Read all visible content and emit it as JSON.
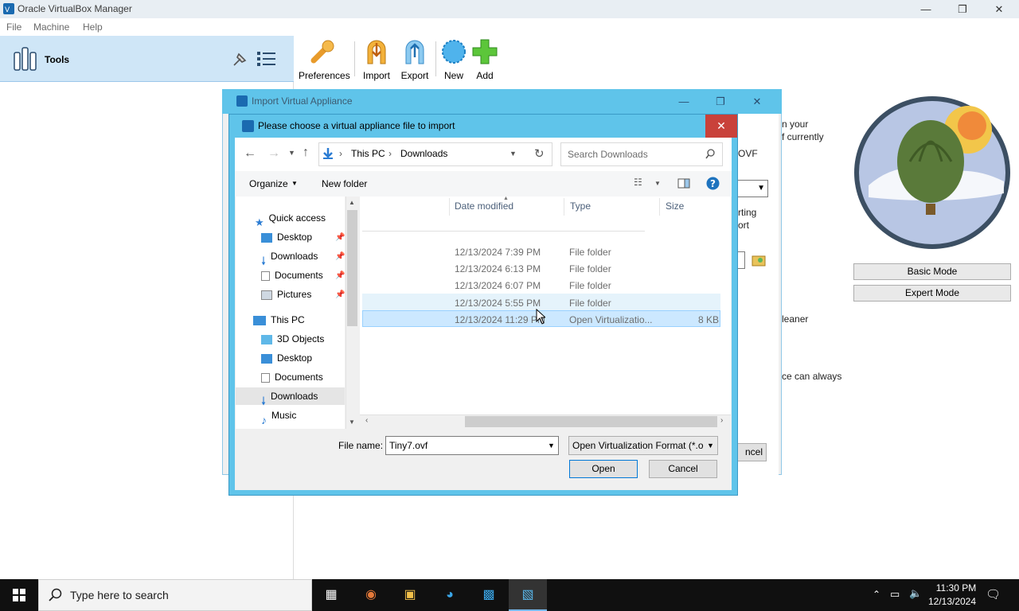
{
  "app": {
    "title": "Oracle VirtualBox Manager",
    "menu": [
      "File",
      "Machine",
      "Help"
    ],
    "tools_label": "Tools",
    "toolbar": [
      "Preferences",
      "Import",
      "Export",
      "New",
      "Add"
    ],
    "window_controls": {
      "minimize": "—",
      "restore": "❐",
      "close": "✕"
    }
  },
  "wizard": {
    "title": "Import Virtual Appliance",
    "side_texts": [
      "n your",
      "f currently",
      "OVF",
      "rting",
      "ort",
      "leaner",
      "ce can always",
      "ncel"
    ],
    "basic_mode": "Basic Mode",
    "expert_mode": "Expert Mode"
  },
  "dialog": {
    "title": "Please choose a virtual appliance file to import",
    "close": "✕",
    "breadcrumb": [
      "This PC",
      "Downloads"
    ],
    "search_placeholder": "Search Downloads",
    "organize": "Organize",
    "new_folder": "New folder",
    "tree": {
      "quick_access": "Quick access",
      "quick_items": [
        "Desktop",
        "Downloads",
        "Documents",
        "Pictures"
      ],
      "this_pc": "This PC",
      "pc_items": [
        "3D Objects",
        "Desktop",
        "Documents",
        "Downloads",
        "Music"
      ]
    },
    "columns": {
      "date": "Date modified",
      "type": "Type",
      "size": "Size"
    },
    "files": [
      {
        "date": "12/13/2024 7:39 PM",
        "type": "File folder",
        "size": ""
      },
      {
        "date": "12/13/2024 6:13 PM",
        "type": "File folder",
        "size": ""
      },
      {
        "date": "12/13/2024 6:07 PM",
        "type": "File folder",
        "size": ""
      },
      {
        "date": "12/13/2024 5:55 PM",
        "type": "File folder",
        "size": ""
      },
      {
        "date": "12/13/2024 11:29 PM",
        "type": "Open Virtualizatio...",
        "size": "8 KB"
      }
    ],
    "file_name_label": "File name:",
    "file_name_value": "Tiny7.ovf",
    "file_type": "Open Virtualization Format (*.o",
    "open": "Open",
    "cancel": "Cancel"
  },
  "taskbar": {
    "search_placeholder": "Type here to search",
    "time": "11:30 PM",
    "date": "12/13/2024"
  }
}
